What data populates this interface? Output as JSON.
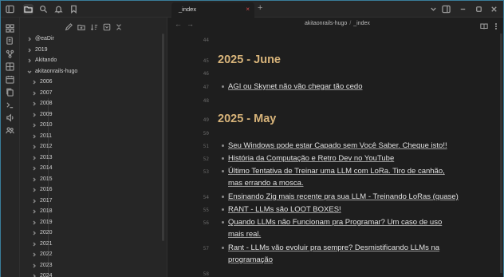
{
  "tab": {
    "title": "_index",
    "close": "×",
    "add": "+"
  },
  "breadcrumb": {
    "folder": "akitaonrails-hugo",
    "separator": "/",
    "file": "_index"
  },
  "nav": {
    "back": "←",
    "forward": "→"
  },
  "sidebar": {
    "items": [
      {
        "label": "@eaDir",
        "expanded": false
      },
      {
        "label": "2019",
        "expanded": false
      },
      {
        "label": "Akitando",
        "expanded": false
      },
      {
        "label": "akitaonrails-hugo",
        "expanded": true
      },
      {
        "label": "2006",
        "expanded": false
      },
      {
        "label": "2007",
        "expanded": false
      },
      {
        "label": "2008",
        "expanded": false
      },
      {
        "label": "2009",
        "expanded": false
      },
      {
        "label": "2010",
        "expanded": false
      },
      {
        "label": "2011",
        "expanded": false
      },
      {
        "label": "2012",
        "expanded": false
      },
      {
        "label": "2013",
        "expanded": false
      },
      {
        "label": "2014",
        "expanded": false
      },
      {
        "label": "2015",
        "expanded": false
      },
      {
        "label": "2016",
        "expanded": false
      },
      {
        "label": "2017",
        "expanded": false
      },
      {
        "label": "2018",
        "expanded": false
      },
      {
        "label": "2019",
        "expanded": false
      },
      {
        "label": "2020",
        "expanded": false
      },
      {
        "label": "2021",
        "expanded": false
      },
      {
        "label": "2022",
        "expanded": false
      },
      {
        "label": "2023",
        "expanded": false
      },
      {
        "label": "2024",
        "expanded": false
      }
    ]
  },
  "editor": {
    "line_numbers": [
      "44",
      "45",
      "46",
      "47",
      "48",
      "49",
      "50",
      "51",
      "52",
      "53",
      "54",
      "55",
      "56",
      "57",
      "58"
    ],
    "heading_june": "2025 - June",
    "june_items": [
      "AGI ou Skynet não vão chegar tão cedo"
    ],
    "heading_may": "2025 - May",
    "may_items": [
      "Seu Windows pode estar Capado sem Você Saber. Cheque isto!!",
      "História da Computação e Retro Dev no YouTube",
      "Último Tentativa de Treinar uma LLM com LoRa. Tiro de canhão,",
      "mas errando a mosca.",
      "Ensinando Zig mais recente pra sua LLM - Treinando LoRas (quase)",
      "RANT - LLMs são LOOT BOXES!",
      "Quando LLMs não Funcionam pra Programar? Um caso de uso",
      "mais real.",
      "Rant - LLMs vão evoluir pra sempre? Desmistificando LLMs na",
      "programação"
    ]
  },
  "colors": {
    "heading": "#d8b47a",
    "accent_border": "#3a7d9a",
    "close": "#d94c4c"
  },
  "icons": {
    "titlebar": [
      "sidebar-toggle-icon",
      "folder-icon",
      "search-icon",
      "bell-icon",
      "bookmark-icon"
    ],
    "ribbon": [
      "grid-icon",
      "pages-icon",
      "branch-icon",
      "blocks-icon",
      "calendar-icon",
      "copy-icon",
      "terminal-icon",
      "audio-icon",
      "people-icon"
    ]
  }
}
